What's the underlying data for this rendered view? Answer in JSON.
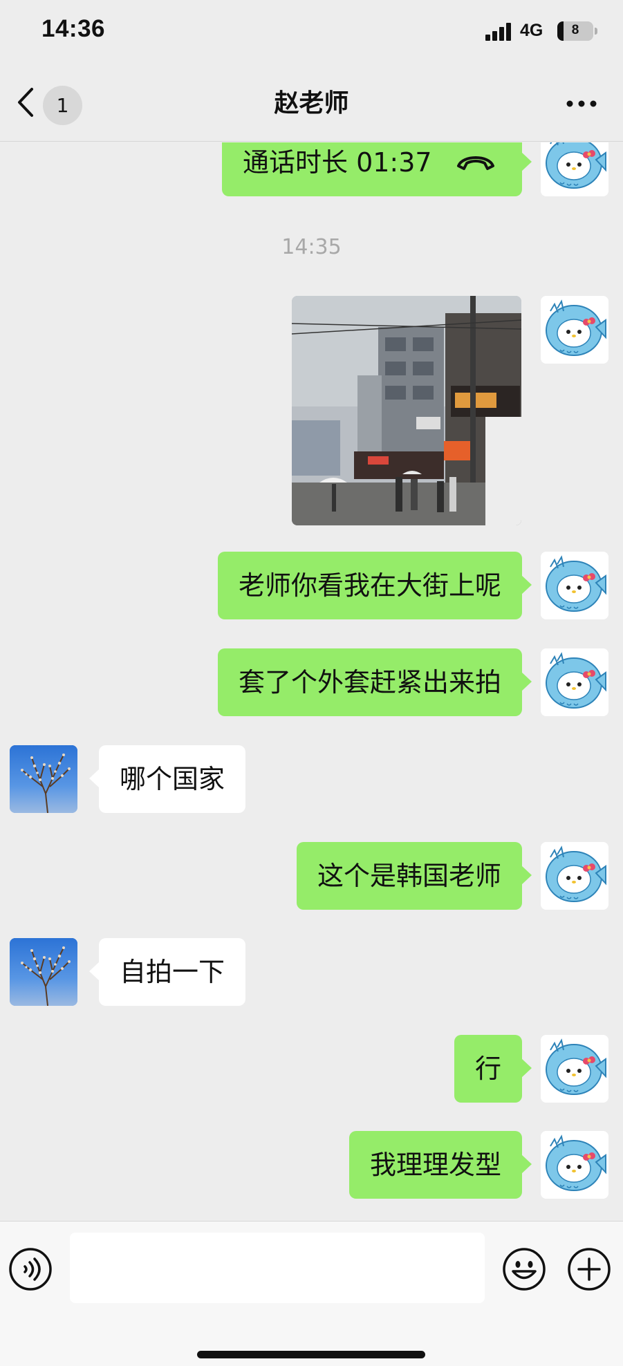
{
  "status_bar": {
    "time": "14:36",
    "network": "4G",
    "battery": "8",
    "battery_level_percent": 8
  },
  "nav": {
    "unread_count": "1",
    "title": "赵老师",
    "icons": [
      "chevron-left-icon",
      "more-icon"
    ]
  },
  "messages": [
    {
      "from": "me",
      "type": "call",
      "text": "通话时长 01:37",
      "icon": "phone-hangup-icon"
    },
    {
      "type": "timestamp",
      "text": "14:35"
    },
    {
      "from": "me",
      "type": "photo",
      "description": "street-photo"
    },
    {
      "from": "me",
      "type": "text",
      "text": "老师你看我在大街上呢"
    },
    {
      "from": "me",
      "type": "text",
      "text": "套了个外套赶紧出来拍"
    },
    {
      "from": "other",
      "type": "text",
      "text": "哪个国家"
    },
    {
      "from": "me",
      "type": "text",
      "text": "这个是韩国老师"
    },
    {
      "from": "other",
      "type": "text",
      "text": "自拍一下"
    },
    {
      "from": "me",
      "type": "text",
      "text": "行"
    },
    {
      "from": "me",
      "type": "text",
      "text": "我理理发型"
    }
  ],
  "input_bar": {
    "value": "",
    "icons": [
      "voice-icon",
      "emoji-icon",
      "plus-icon"
    ]
  },
  "colors": {
    "background": "#ededed",
    "my_bubble": "#95ec69",
    "their_bubble": "#ffffff",
    "timestamp_text": "#a8a8a8"
  }
}
